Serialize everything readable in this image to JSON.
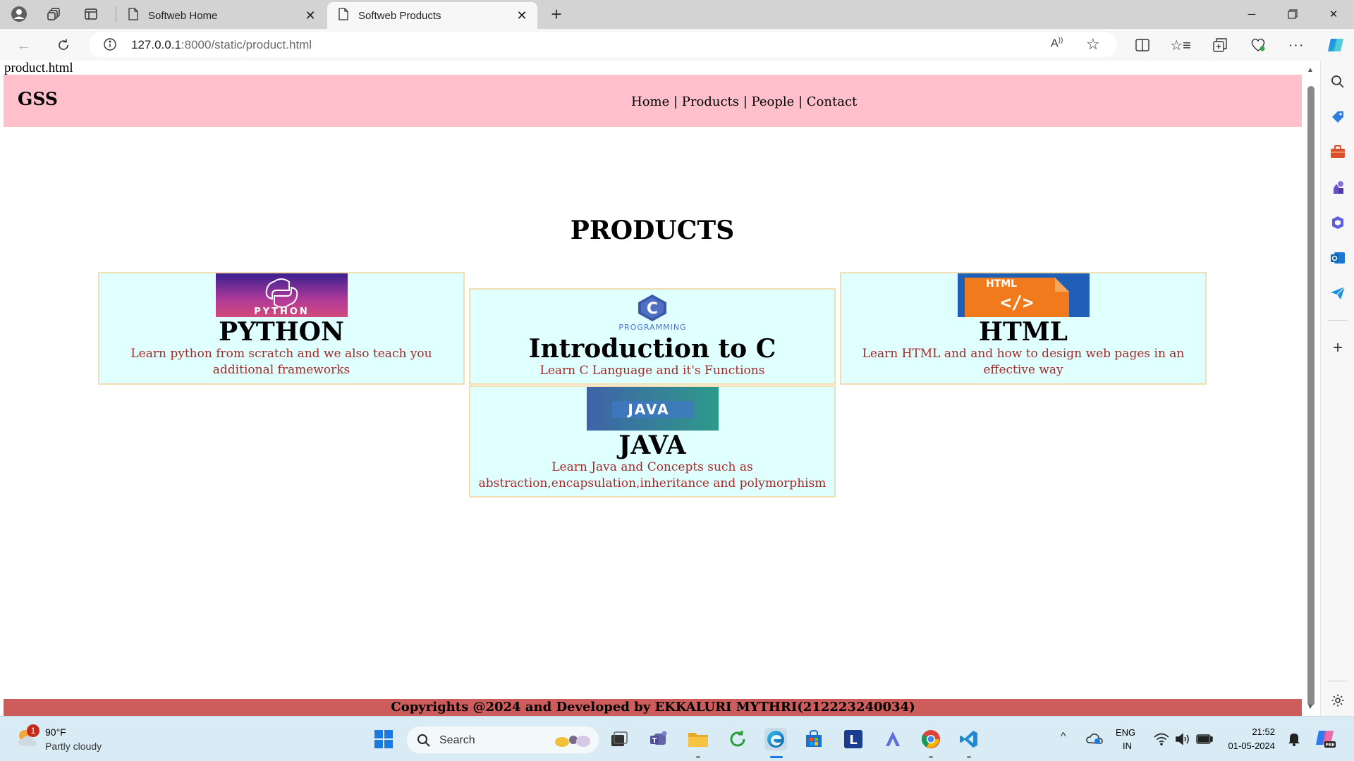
{
  "browser": {
    "tabs": [
      {
        "title": "Softweb Home",
        "active": false
      },
      {
        "title": "Softweb Products",
        "active": true
      }
    ],
    "url_host": "127.0.0.1",
    "url_rest": ":8000/static/product.html"
  },
  "page": {
    "file_label": "product.html",
    "brand": "GSS",
    "nav": [
      "Home",
      "Products",
      "People",
      "Contact"
    ],
    "nav_sep": " | ",
    "heading": "PRODUCTS",
    "products": [
      {
        "image_text": "PYTHON",
        "title": "PYTHON",
        "description": "Learn python from scratch and we also teach you additional frameworks"
      },
      {
        "image_text": "PROGRAMMING",
        "title": "Introduction to C",
        "description": "Learn C Language and it's Functions"
      },
      {
        "image_text": "HTML",
        "title": "HTML",
        "description": "Learn HTML and and how to design web pages in an effective way"
      },
      {
        "image_text": "JAVA",
        "title": "JAVA",
        "description": "Learn Java and Concepts such as abstraction,encapsulation,inheritance and polymorphism"
      }
    ],
    "footer": "Copyrights @2024 and Developed by EKKALURI MYTHRI(212223240034)"
  },
  "taskbar": {
    "weather_temp": "90°F",
    "weather_desc": "Partly cloudy",
    "weather_badge": "1",
    "search_label": "Search",
    "lang_1": "ENG",
    "lang_2": "IN",
    "time": "21:52",
    "date": "01-05-2024"
  },
  "colors": {
    "navbar": "#ffc0cb",
    "card_bg": "#e0ffff",
    "card_text": "#a52a2a",
    "footer": "#cd5c5c"
  }
}
